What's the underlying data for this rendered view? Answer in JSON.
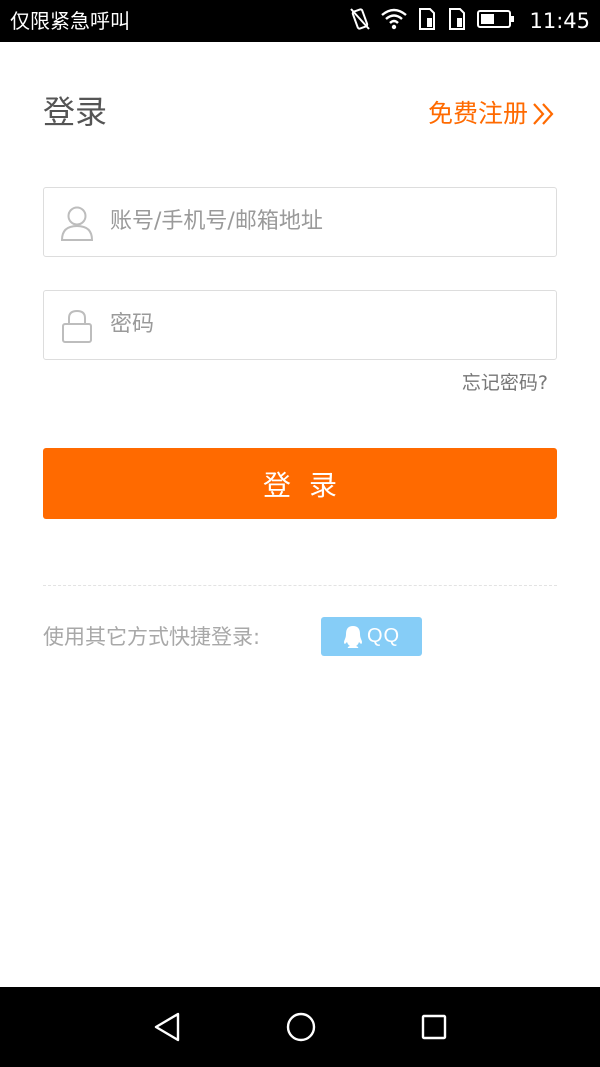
{
  "status_bar": {
    "carrier": "仅限紧急呼叫",
    "time": "11:45",
    "icons": [
      "vibrate-icon",
      "wifi-icon",
      "sim1-icon",
      "sim2-icon",
      "battery-icon"
    ]
  },
  "header": {
    "title": "登录",
    "register_label": "免费注册"
  },
  "form": {
    "account_placeholder": "账号/手机号/邮箱地址",
    "password_placeholder": "密码",
    "forgot_label": "忘记密码?",
    "login_label": "登录"
  },
  "other_login": {
    "label": "使用其它方式快捷登录:",
    "qq_label": "QQ"
  },
  "colors": {
    "accent": "#ff6a00",
    "qq": "#86cdf7"
  }
}
